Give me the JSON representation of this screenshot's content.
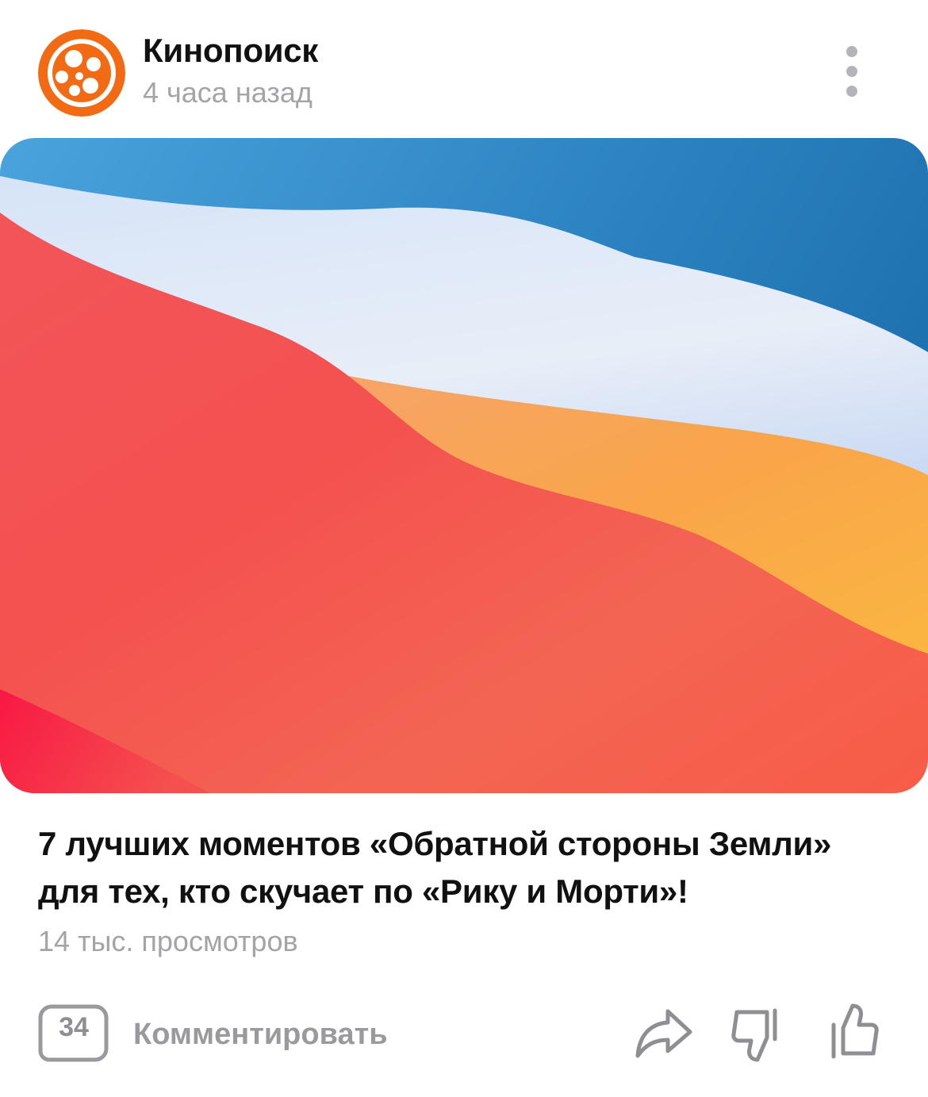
{
  "header": {
    "channel_name": "Кинопоиск",
    "time_ago": "4 часа назад",
    "logo_icon": "kinopoisk-film-reel-icon",
    "more_icon": "more-vertical-icon"
  },
  "article": {
    "title": "7 лучших моментов «Обратной стороны Земли» для тех, кто скучает по «Рику и Морти»!",
    "views": "14 тыс. просмотров"
  },
  "footer": {
    "comment_count": "34",
    "comment_label": "Комментировать",
    "share_icon": "share-arrow-icon",
    "dislike_icon": "thumbs-down-icon",
    "like_icon": "thumbs-up-icon"
  },
  "colors": {
    "brand_orange": "#f26a14",
    "text_primary": "#111111",
    "text_secondary": "#a4a4a8",
    "icon_gray": "#8e8e93"
  }
}
